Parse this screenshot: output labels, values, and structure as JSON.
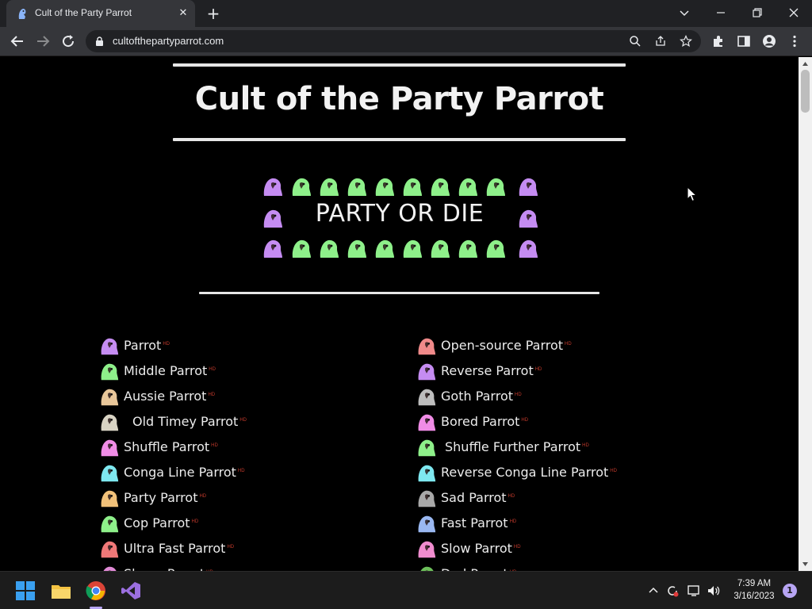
{
  "browser": {
    "tab_title": "Cult of the Party Parrot",
    "tab_close": "✕",
    "new_tab": "+",
    "url": "cultofthepartyparrot.com"
  },
  "page": {
    "title": "Cult of the Party Parrot",
    "party_text": "PARTY OR DIE",
    "badge": "HD",
    "parrots_left": [
      {
        "name": "Parrot",
        "color": "#c58cf2"
      },
      {
        "name": "Middle Parrot",
        "color": "#8ef08a"
      },
      {
        "name": "Aussie Parrot",
        "color": "#e9c79a"
      },
      {
        "name": "Old Timey Parrot",
        "color": "#d9d4c4"
      },
      {
        "name": "Shuffle Parrot",
        "color": "#f08ce6"
      },
      {
        "name": "Conga Line Parrot",
        "color": "#7ee8f0"
      },
      {
        "name": "Party Parrot",
        "color": "#f2c27a"
      },
      {
        "name": "Cop Parrot",
        "color": "#8ef08a"
      },
      {
        "name": "Ultra Fast Parrot",
        "color": "#f07878"
      },
      {
        "name": "Slomo Parrot",
        "color": "#e08ad6"
      }
    ],
    "parrots_right": [
      {
        "name": "Open-source Parrot",
        "color": "#f08a8a"
      },
      {
        "name": "Reverse Parrot",
        "color": "#c58cf2"
      },
      {
        "name": "Goth Parrot",
        "color": "#bdbdbd"
      },
      {
        "name": "Bored Parrot",
        "color": "#f08ce6"
      },
      {
        "name": "Shuffle Further Parrot",
        "color": "#8ef08a"
      },
      {
        "name": "Reverse Conga Line Parrot",
        "color": "#7ee8f0"
      },
      {
        "name": "Sad Parrot",
        "color": "#a8a8a8"
      },
      {
        "name": "Fast Parrot",
        "color": "#9ab8f2"
      },
      {
        "name": "Slow Parrot",
        "color": "#f08ccf"
      },
      {
        "name": "Dad Parrot",
        "color": "#6cbf5a"
      }
    ]
  },
  "taskbar": {
    "time": "7:39 AM",
    "date": "3/16/2023",
    "notification_count": "1"
  },
  "colors": {
    "purple_parrot": "#c58cf2",
    "green_parrot": "#8ef08a"
  }
}
